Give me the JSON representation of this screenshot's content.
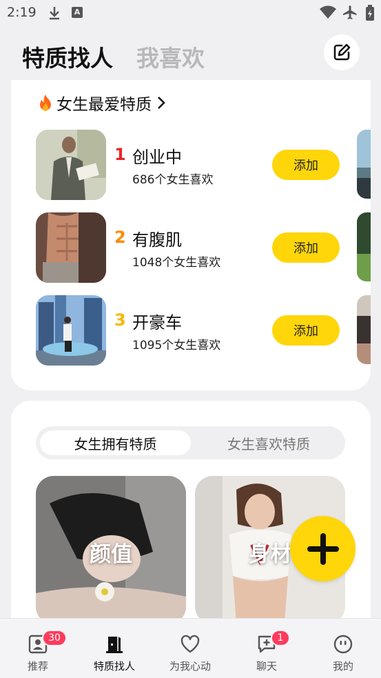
{
  "status_bar": {
    "time": "2:19",
    "badge_letter": "A",
    "icons": [
      "download-icon",
      "a-notification-icon",
      "wifi-icon",
      "airplane-icon",
      "battery-charging-icon"
    ]
  },
  "header": {
    "tab_active": "特质找人",
    "tab_inactive": "我喜欢",
    "edit_icon": "edit-icon"
  },
  "ranking": {
    "title": "女生最爱特质",
    "title_icon": "flame-icon",
    "items": [
      {
        "rank": "1",
        "name": "创业中",
        "count": "686个女生喜欢",
        "button": "添加",
        "rank_color": "#e8262c"
      },
      {
        "rank": "2",
        "name": "有腹肌",
        "count": "1048个女生喜欢",
        "button": "添加",
        "rank_color": "#ff8a00"
      },
      {
        "rank": "3",
        "name": "开豪车",
        "count": "1095个女生喜欢",
        "button": "添加",
        "rank_color": "#f5b800"
      }
    ]
  },
  "features": {
    "segment_active": "女生拥有特质",
    "segment_inactive": "女生喜欢特质",
    "cards": [
      {
        "label": "颜值"
      },
      {
        "label": "身材"
      }
    ]
  },
  "fab": {
    "icon": "plus-icon"
  },
  "bottom_nav": [
    {
      "label": "推荐",
      "icon": "profile-card-icon",
      "badge": "30"
    },
    {
      "label": "特质找人",
      "icon": "door-icon",
      "badge": ""
    },
    {
      "label": "为我心动",
      "icon": "heart-icon",
      "badge": ""
    },
    {
      "label": "聊天",
      "icon": "chat-plus-icon",
      "badge": "1"
    },
    {
      "label": "我的",
      "icon": "face-icon",
      "badge": ""
    }
  ],
  "colors": {
    "accent_yellow": "#ffd60a",
    "badge_red": "#ff3b5c",
    "background": "#f0f0f2"
  }
}
